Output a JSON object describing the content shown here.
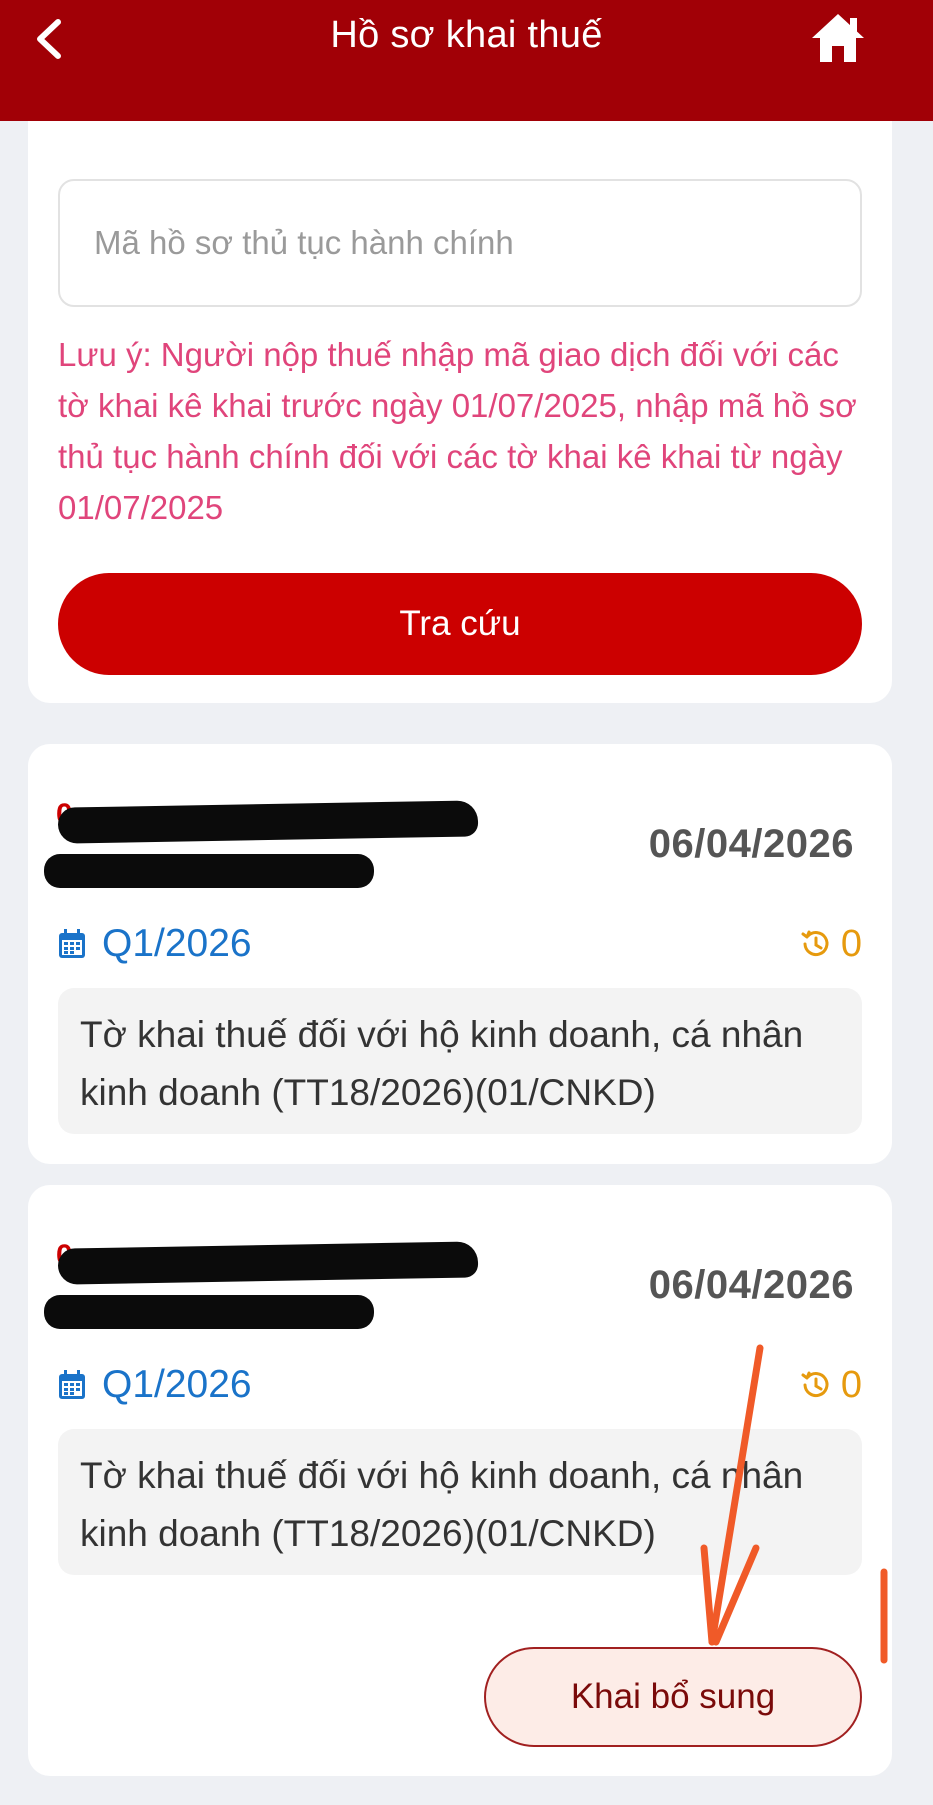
{
  "header": {
    "title": "Hồ sơ khai thuế",
    "back_icon": "chevron-left-icon",
    "home_icon": "home-icon"
  },
  "search": {
    "placeholder": "Mã hồ sơ thủ tục hành chính",
    "value": "",
    "note": "Lưu ý: Người nộp thuế nhập mã giao dịch đối với các tờ khai kê khai trước ngày 01/07/2025, nhập mã hồ sơ thủ tục hành chính đối với các tờ khai kê khai từ ngày 01/07/2025",
    "button_label": "Tra cứu"
  },
  "records": [
    {
      "code_redacted": true,
      "date": "06/04/2026",
      "period": "Q1/2026",
      "history_count": "0",
      "description": "Tờ khai thuế đối với hộ kinh doanh, cá nhân kinh doanh (TT18/2026)(01/CNKD)"
    },
    {
      "code_redacted": true,
      "date": "06/04/2026",
      "period": "Q1/2026",
      "history_count": "0",
      "description": "Tờ khai thuế đối với hộ kinh doanh, cá nhân kinh doanh (TT18/2026)(01/CNKD)",
      "action_label": "Khai bổ sung"
    }
  ],
  "colors": {
    "header_bg": "#a10006",
    "primary_button": "#cc0000",
    "note_text": "#e0457b",
    "period_text": "#1a73c9",
    "history_text": "#e69a0e",
    "annotation": "#f05a28"
  }
}
